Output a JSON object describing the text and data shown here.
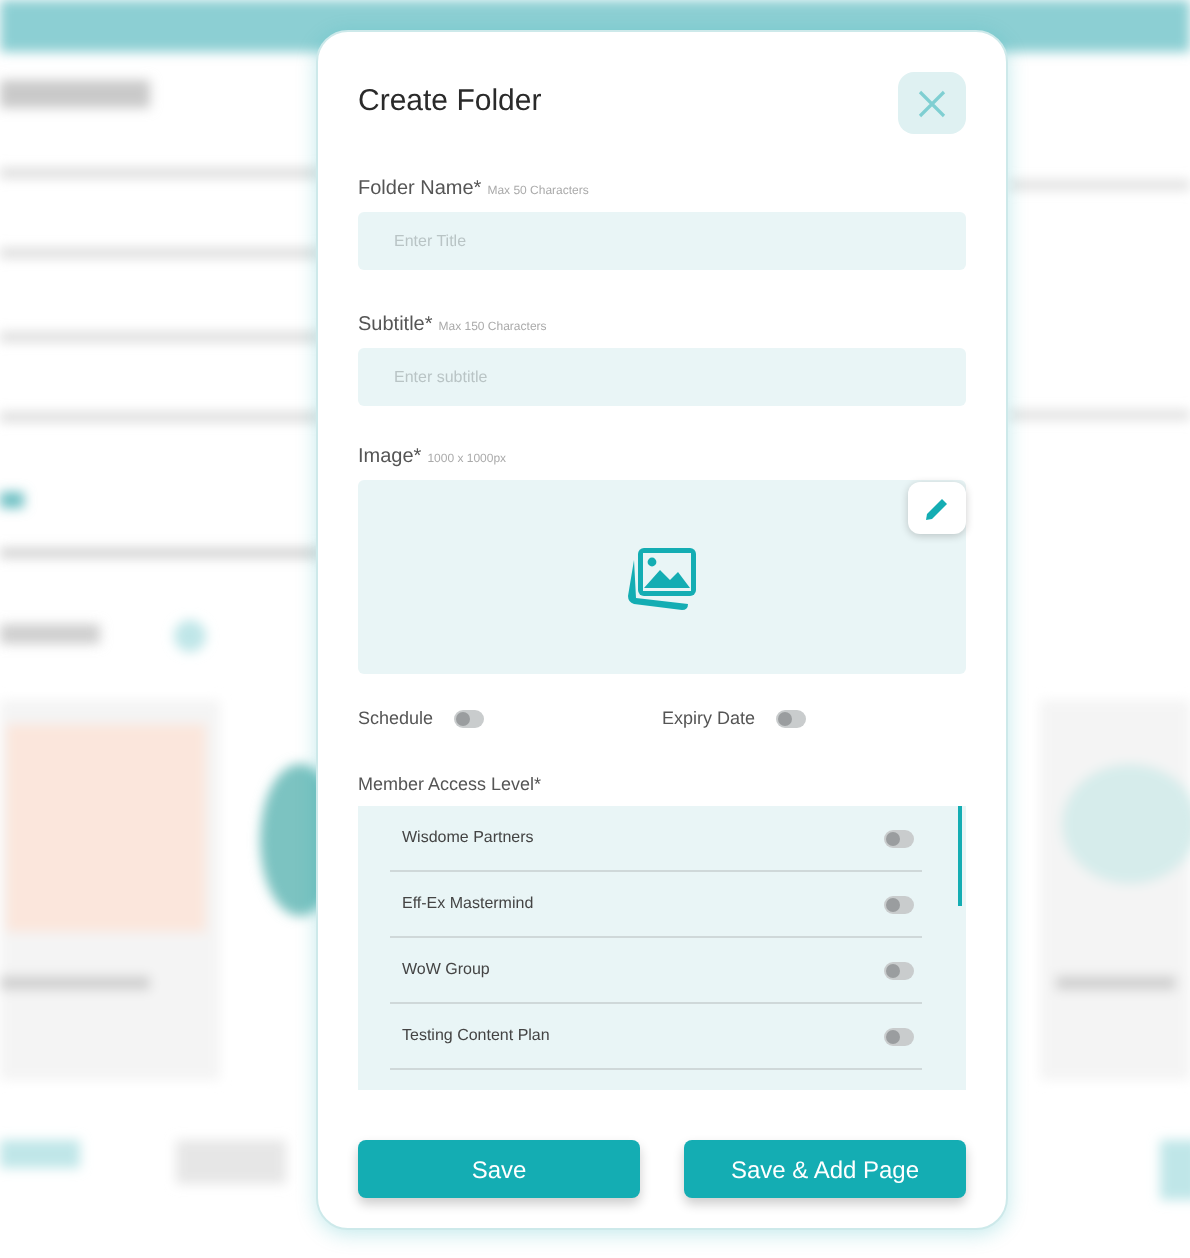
{
  "dialog": {
    "title": "Create Folder",
    "fields": [
      {
        "label": "Folder Name*",
        "hint": "Max 50 Characters",
        "placeholder": "Enter Title"
      },
      {
        "label": "Subtitle*",
        "hint": "Max 150 Characters",
        "placeholder": "Enter subtitle"
      }
    ],
    "image": {
      "label": "Image*",
      "hint": "1000 x 1000px"
    },
    "toggles": [
      {
        "label": "Schedule",
        "on": false
      },
      {
        "label": "Expiry Date",
        "on": false
      }
    ],
    "access": {
      "label": "Member Access Level*",
      "items": [
        {
          "name": "Wisdome Partners",
          "on": false
        },
        {
          "name": "Eff-Ex Mastermind",
          "on": false
        },
        {
          "name": "WoW Group",
          "on": false
        },
        {
          "name": "Testing Content Plan",
          "on": false
        }
      ]
    },
    "buttons": [
      "Save",
      "Save & Add Page"
    ]
  }
}
